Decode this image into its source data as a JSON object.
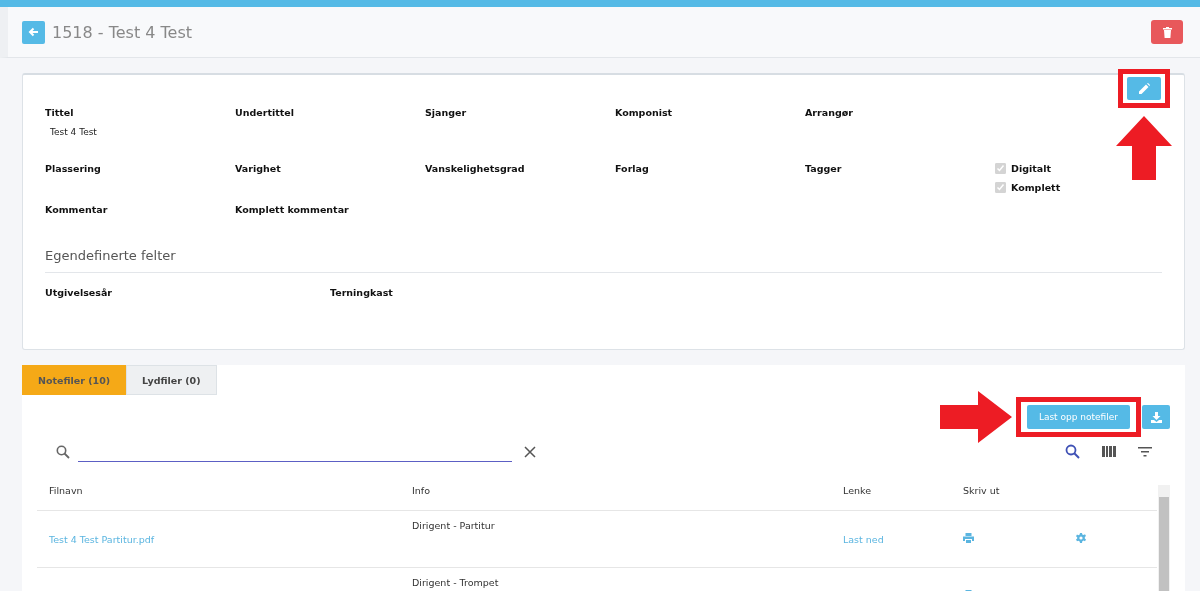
{
  "header": {
    "title": "1518 - Test 4 Test"
  },
  "details": {
    "field_rows": [
      [
        {
          "label": "Tittel",
          "value": "Test 4 Test"
        },
        {
          "label": "Undertittel"
        },
        {
          "label": "Sjanger"
        },
        {
          "label": "Komponist"
        },
        {
          "label": "Arrangør"
        }
      ],
      [
        {
          "label": "Plassering"
        },
        {
          "label": "Varighet"
        },
        {
          "label": "Vanskelighetsgrad"
        },
        {
          "label": "Forlag"
        },
        {
          "label": "Tagger"
        }
      ],
      [
        {
          "label": "Kommentar"
        },
        {
          "label": "Komplett kommentar"
        }
      ]
    ],
    "checkboxes": [
      {
        "label": "Digitalt",
        "checked": true,
        "disabled": true
      },
      {
        "label": "Komplett",
        "checked": true,
        "disabled": true
      }
    ],
    "custom_heading": "Egendefinerte felter",
    "custom_fields": [
      {
        "label": "Utgivelsesår"
      },
      {
        "label": "Terningkast"
      }
    ]
  },
  "tabs": [
    {
      "label": "Notefiler (10)",
      "selected": true
    },
    {
      "label": "Lydfiler (0)",
      "selected": false
    }
  ],
  "upload_button": "Last opp notefiler",
  "table": {
    "columns": [
      "Filnavn",
      "Info",
      "Lenke",
      "Skriv ut"
    ],
    "rows": [
      {
        "filename": "Test 4 Test Partitur.pdf",
        "info": "Dirigent - Partitur",
        "link": "Last ned"
      },
      {
        "info": "Dirigent - Trompet"
      }
    ]
  }
}
